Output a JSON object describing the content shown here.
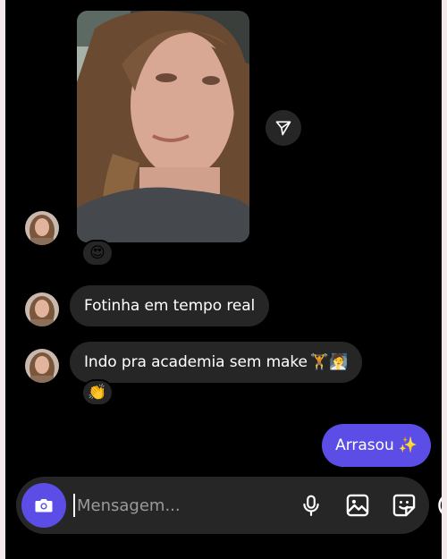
{
  "messages": [
    {
      "type": "photo",
      "reaction": "😍"
    },
    {
      "type": "text",
      "text": "Fotinha em tempo real"
    },
    {
      "type": "text",
      "text": "Indo pra academia sem make",
      "emoji": "🏋🧖",
      "reaction": "👏"
    }
  ],
  "outgoing": {
    "text": "Arrasou",
    "emoji": "✨"
  },
  "composer": {
    "placeholder": "Mensagem..."
  },
  "icons": {
    "share": "share-icon",
    "camera": "camera-icon",
    "mic": "microphone-icon",
    "gallery": "gallery-icon",
    "sticker": "sticker-icon",
    "more": "plus-icon"
  },
  "colors": {
    "accent": "#5b4de6",
    "bubble": "#262626",
    "background": "#000000"
  }
}
